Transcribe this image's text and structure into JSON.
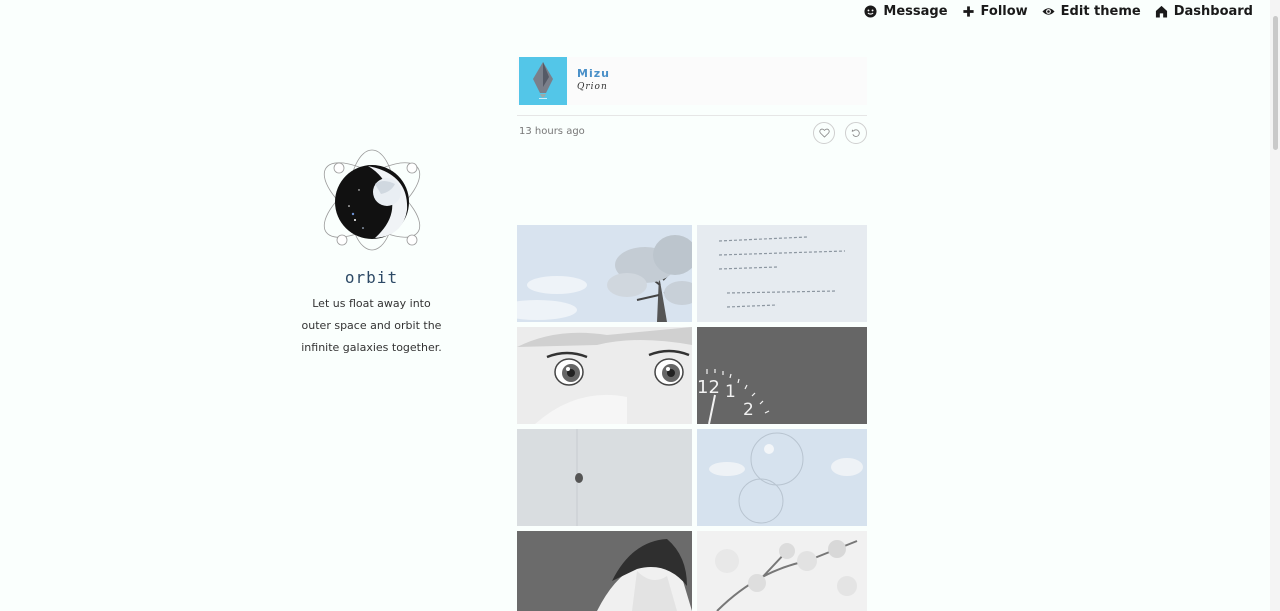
{
  "nav": {
    "message": "Message",
    "follow": "Follow",
    "edit_theme": "Edit theme",
    "dashboard": "Dashboard"
  },
  "sidebar": {
    "title": "orbit",
    "description_lines": [
      "Let us float away into",
      "outer space and orbit the",
      "infinite galaxies together."
    ]
  },
  "post": {
    "song": {
      "title": "Mizu",
      "artist": "Qrion"
    },
    "time": "13 hours ago"
  },
  "colors": {
    "accent": "#4a90c8",
    "album_bg": "#53c6e8",
    "page_bg": "#fafffd"
  },
  "icons": [
    "message-icon",
    "plus-icon",
    "eye-icon",
    "home-icon",
    "heart-icon",
    "reblog-icon"
  ]
}
